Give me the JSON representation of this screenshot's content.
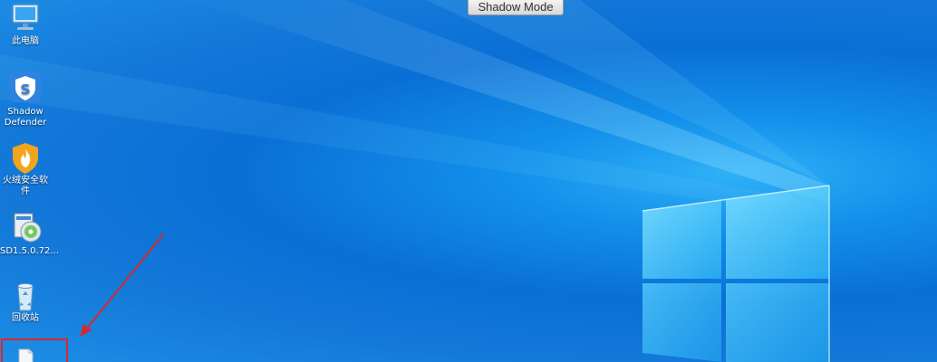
{
  "shadow_banner": {
    "label": "Shadow Mode"
  },
  "desktop_icons": [
    {
      "name": "this-pc",
      "label": "此电脑",
      "icon": "monitor-icon"
    },
    {
      "name": "shadow-defender",
      "label": "Shadow\nDefender",
      "icon": "shield-s-icon"
    },
    {
      "name": "huorong",
      "label": "火绒安全软件",
      "icon": "flame-shield-icon"
    },
    {
      "name": "sd-installer",
      "label": "SD1.5.0.72...",
      "icon": "installer-disc-icon"
    },
    {
      "name": "recycle-bin",
      "label": "回收站",
      "icon": "recycle-bin-icon"
    },
    {
      "name": "new-file",
      "label": "",
      "icon": "file-icon"
    }
  ],
  "colors": {
    "desktop_center": "#2fb1f7",
    "desktop_edge": "#0a6fd6",
    "annotation": "#d9282c"
  },
  "annotation": {
    "type": "arrow-and-box",
    "target": "new-file"
  }
}
